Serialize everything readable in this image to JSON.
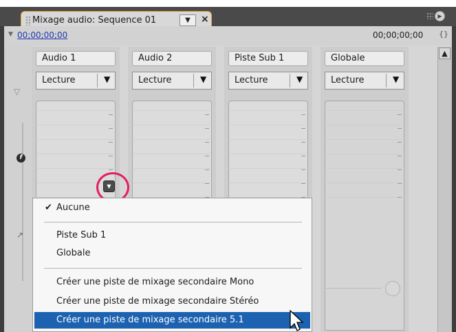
{
  "window": {
    "tab_title": "Mixage audio: Sequence 01",
    "tab_menu_glyph": "▼",
    "tab_close_glyph": "×"
  },
  "timecode": {
    "current": "00;00;00;00",
    "duration": "00;00;00;00"
  },
  "tracks": [
    {
      "name": "Audio 1",
      "mode": "Lecture"
    },
    {
      "name": "Audio 2",
      "mode": "Lecture"
    },
    {
      "name": "Piste Sub 1",
      "mode": "Lecture"
    },
    {
      "name": "Globale",
      "mode": "Lecture"
    }
  ],
  "dropdown_arrow": "▼",
  "submix_menu": {
    "items": [
      {
        "label": "Aucune",
        "checked": true
      },
      {
        "label": "Piste Sub 1",
        "checked": false
      },
      {
        "label": "Globale",
        "checked": false
      },
      {
        "label": "Créer une piste de mixage secondaire Mono",
        "checked": false
      },
      {
        "label": "Créer une piste de mixage secondaire Stéréo",
        "checked": false
      },
      {
        "label": "Créer une piste de mixage secondaire 5.1",
        "checked": false,
        "highlighted": true
      }
    ],
    "check_glyph": "✔"
  },
  "colors": {
    "highlight_ring": "#e0205f",
    "selection": "#1c62b0",
    "tab_border": "#e8a23a",
    "timecode_link": "#1f36b0"
  },
  "icons": {
    "effects": "fx-icon",
    "sends": "send-icon",
    "collapse": "collapse-triangle-icon",
    "scroll_up": "scroll-up-arrow-icon",
    "pointer": "mouse-pointer-icon"
  }
}
